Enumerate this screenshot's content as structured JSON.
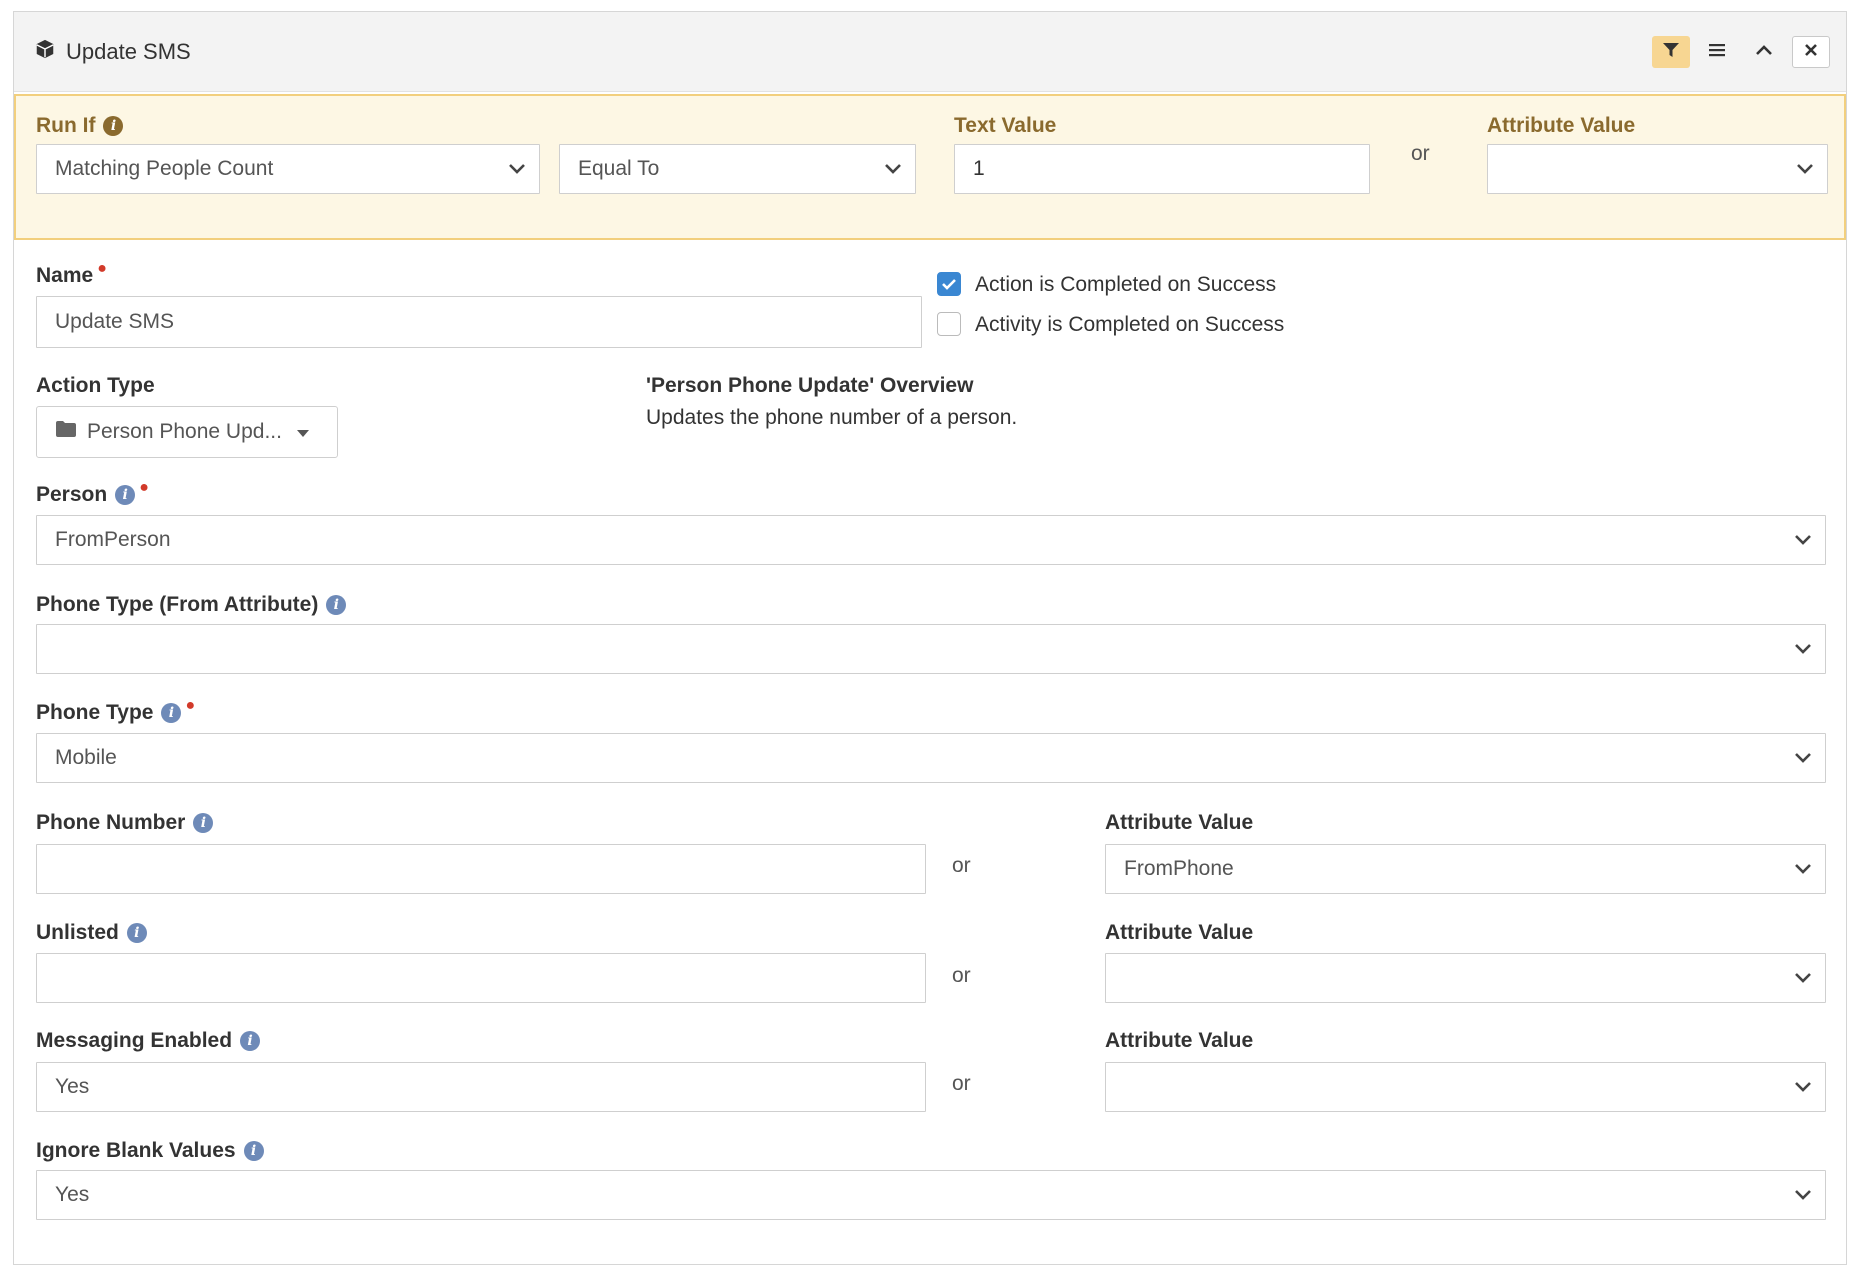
{
  "header": {
    "title": "Update SMS"
  },
  "run_if": {
    "label": "Run If",
    "condition_field": "Matching People Count",
    "comparison": "Equal To",
    "text_value_label": "Text Value",
    "text_value": "1",
    "or_label": "or",
    "attribute_value_label": "Attribute Value",
    "attribute_value": ""
  },
  "form": {
    "name_label": "Name",
    "name_value": "Update SMS",
    "action_completed_label": "Action is Completed on Success",
    "action_completed_checked": true,
    "activity_completed_label": "Activity is Completed on Success",
    "activity_completed_checked": false,
    "action_type_label": "Action Type",
    "action_type_value": "Person Phone Upd...",
    "overview_title": "'Person Phone Update' Overview",
    "overview_text": "Updates the phone number of a person.",
    "person_label": "Person",
    "person_value": "FromPerson",
    "phone_type_attr_label": "Phone Type (From Attribute)",
    "phone_type_attr_value": "",
    "phone_type_label": "Phone Type",
    "phone_type_value": "Mobile",
    "phone_number_label": "Phone Number",
    "phone_number_value": "",
    "phone_number_attr_label": "Attribute Value",
    "phone_number_attr_value": "FromPhone",
    "unlisted_label": "Unlisted",
    "unlisted_value": "",
    "unlisted_attr_label": "Attribute Value",
    "unlisted_attr_value": "",
    "messaging_label": "Messaging Enabled",
    "messaging_value": "Yes",
    "messaging_attr_label": "Attribute Value",
    "messaging_attr_value": "",
    "ignore_blank_label": "Ignore Blank Values",
    "ignore_blank_value": "Yes",
    "or_label": "or"
  },
  "colors": {
    "accent_blue": "#3a87d2",
    "filter_active": "#f7d692",
    "runif_bg": "#fdf7e4",
    "runif_border": "#f2cf7d",
    "required": "#d23a2a",
    "info_icon": "#6e8ab8"
  },
  "icons": {
    "header": "cube-icon",
    "filter": "filter-icon",
    "menu": "hamburger-menu-icon",
    "collapse": "chevron-up-icon",
    "close": "close-icon",
    "action_type": "folder-icon"
  }
}
